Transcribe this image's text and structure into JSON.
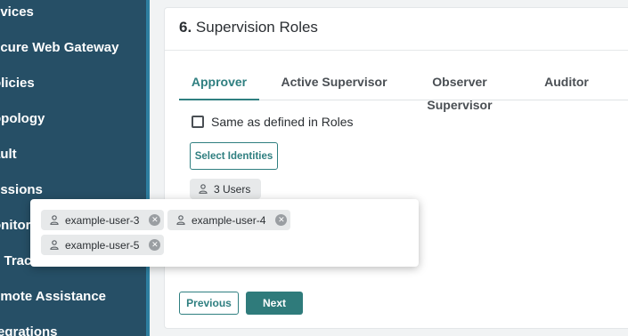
{
  "sidebar": {
    "items": [
      {
        "label": "evices"
      },
      {
        "label": "ecure Web Gateway"
      },
      {
        "label": "olicies"
      },
      {
        "label": "opology"
      },
      {
        "label": "ault"
      },
      {
        "label": "essions"
      },
      {
        "label": "onitor"
      },
      {
        "label": "e Trac"
      },
      {
        "label": "emote Assistance"
      },
      {
        "label": "tegrations"
      }
    ]
  },
  "section": {
    "number": "6.",
    "title": "Supervision Roles"
  },
  "tabs": [
    {
      "label": "Approver",
      "active": true
    },
    {
      "label": "Active Supervisor",
      "active": false
    },
    {
      "label": "Observer Supervisor",
      "active": false
    },
    {
      "label": "Auditor",
      "active": false
    }
  ],
  "checkbox": {
    "label": "Same as defined in Roles",
    "checked": false
  },
  "select_button": {
    "label": "Select Identities"
  },
  "users_chip": {
    "label": "3 Users",
    "icon": "person-icon"
  },
  "popup": {
    "users": [
      {
        "label": "example-user-3"
      },
      {
        "label": "example-user-4"
      },
      {
        "label": "example-user-5"
      }
    ]
  },
  "footer": {
    "previous_label": "Previous",
    "next_label": "Next"
  },
  "colors": {
    "sidebar": "#264f66",
    "accent": "#2f7f80"
  }
}
